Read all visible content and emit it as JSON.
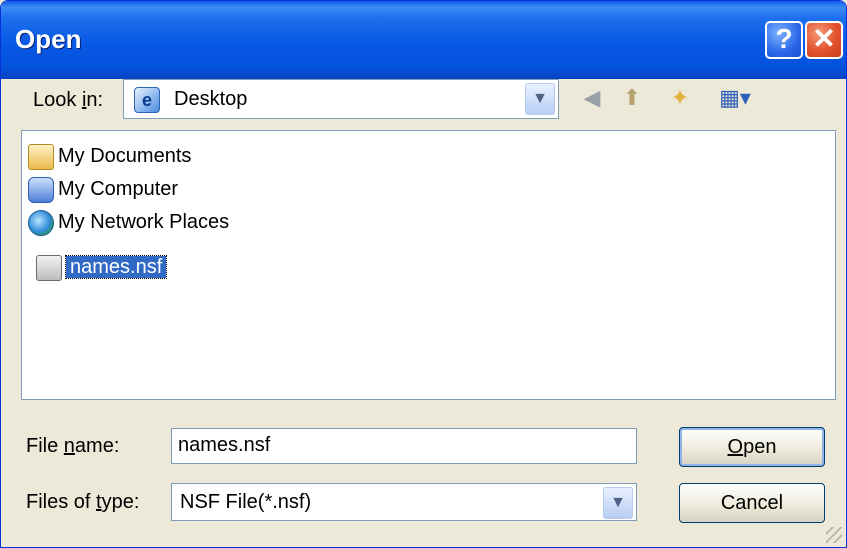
{
  "window": {
    "title": "Open"
  },
  "title_buttons": {
    "help": "?",
    "close": "✕"
  },
  "look_in": {
    "label_pre": "Look ",
    "label_key": "i",
    "label_post": "n:",
    "value": "Desktop",
    "icon": "desktop-icon"
  },
  "toolbar": {
    "back": "back-icon",
    "up": "up-folder-icon",
    "new_folder": "new-folder-icon",
    "views": "views-menu-icon"
  },
  "files": [
    {
      "name": "My Documents",
      "icon": "my-documents-icon"
    },
    {
      "name": "My Computer",
      "icon": "my-computer-icon"
    },
    {
      "name": "My Network Places",
      "icon": "network-places-icon"
    },
    {
      "name": "names.nsf",
      "icon": "nsf-file-icon",
      "selected": true
    }
  ],
  "file_name": {
    "label_pre": "File ",
    "label_key": "n",
    "label_post": "ame:",
    "value": "names.nsf"
  },
  "file_type": {
    "label_pre": "Files of ",
    "label_key": "t",
    "label_post": "ype:",
    "value": "NSF File(*.nsf)"
  },
  "buttons": {
    "open_key": "O",
    "open_rest": "pen",
    "cancel": "Cancel"
  }
}
